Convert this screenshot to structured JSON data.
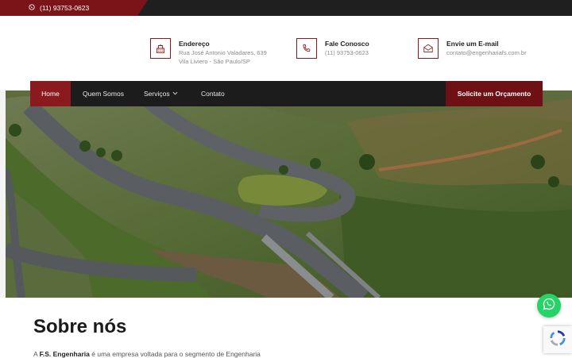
{
  "topbar": {
    "phone": "(11) 93753-0623",
    "icon": "whatsapp-icon"
  },
  "info": {
    "address": {
      "title": "Endereço",
      "line1": "Rua José Antonio Valadares, 639",
      "line2": "Vila Liviero - São Paulo/SP",
      "icon": "building-icon"
    },
    "phone": {
      "title": "Fale Conosco",
      "line1": "(11) 93753-0623",
      "icon": "phone-icon"
    },
    "mail": {
      "title": "Envie um E-mail",
      "line1": "contato@engenhariafs.com.br",
      "icon": "envelope-icon"
    }
  },
  "nav": {
    "items": [
      {
        "label": "Home",
        "active": true
      },
      {
        "label": "Quem Somos"
      },
      {
        "label": "Serviços",
        "has_dropdown": true
      },
      {
        "label": "Contato"
      }
    ],
    "cta_label": "Solicite um Orçamento"
  },
  "about": {
    "title": "Sobre nós",
    "text_prefix": "A",
    "company": "F.S. Engenharia",
    "text_suffix": "é uma empresa voltada para o segmento de Engenharia"
  },
  "colors": {
    "brand_red": "#8b1a1e",
    "dark": "#1c1c1c",
    "whatsapp": "#25d366"
  }
}
